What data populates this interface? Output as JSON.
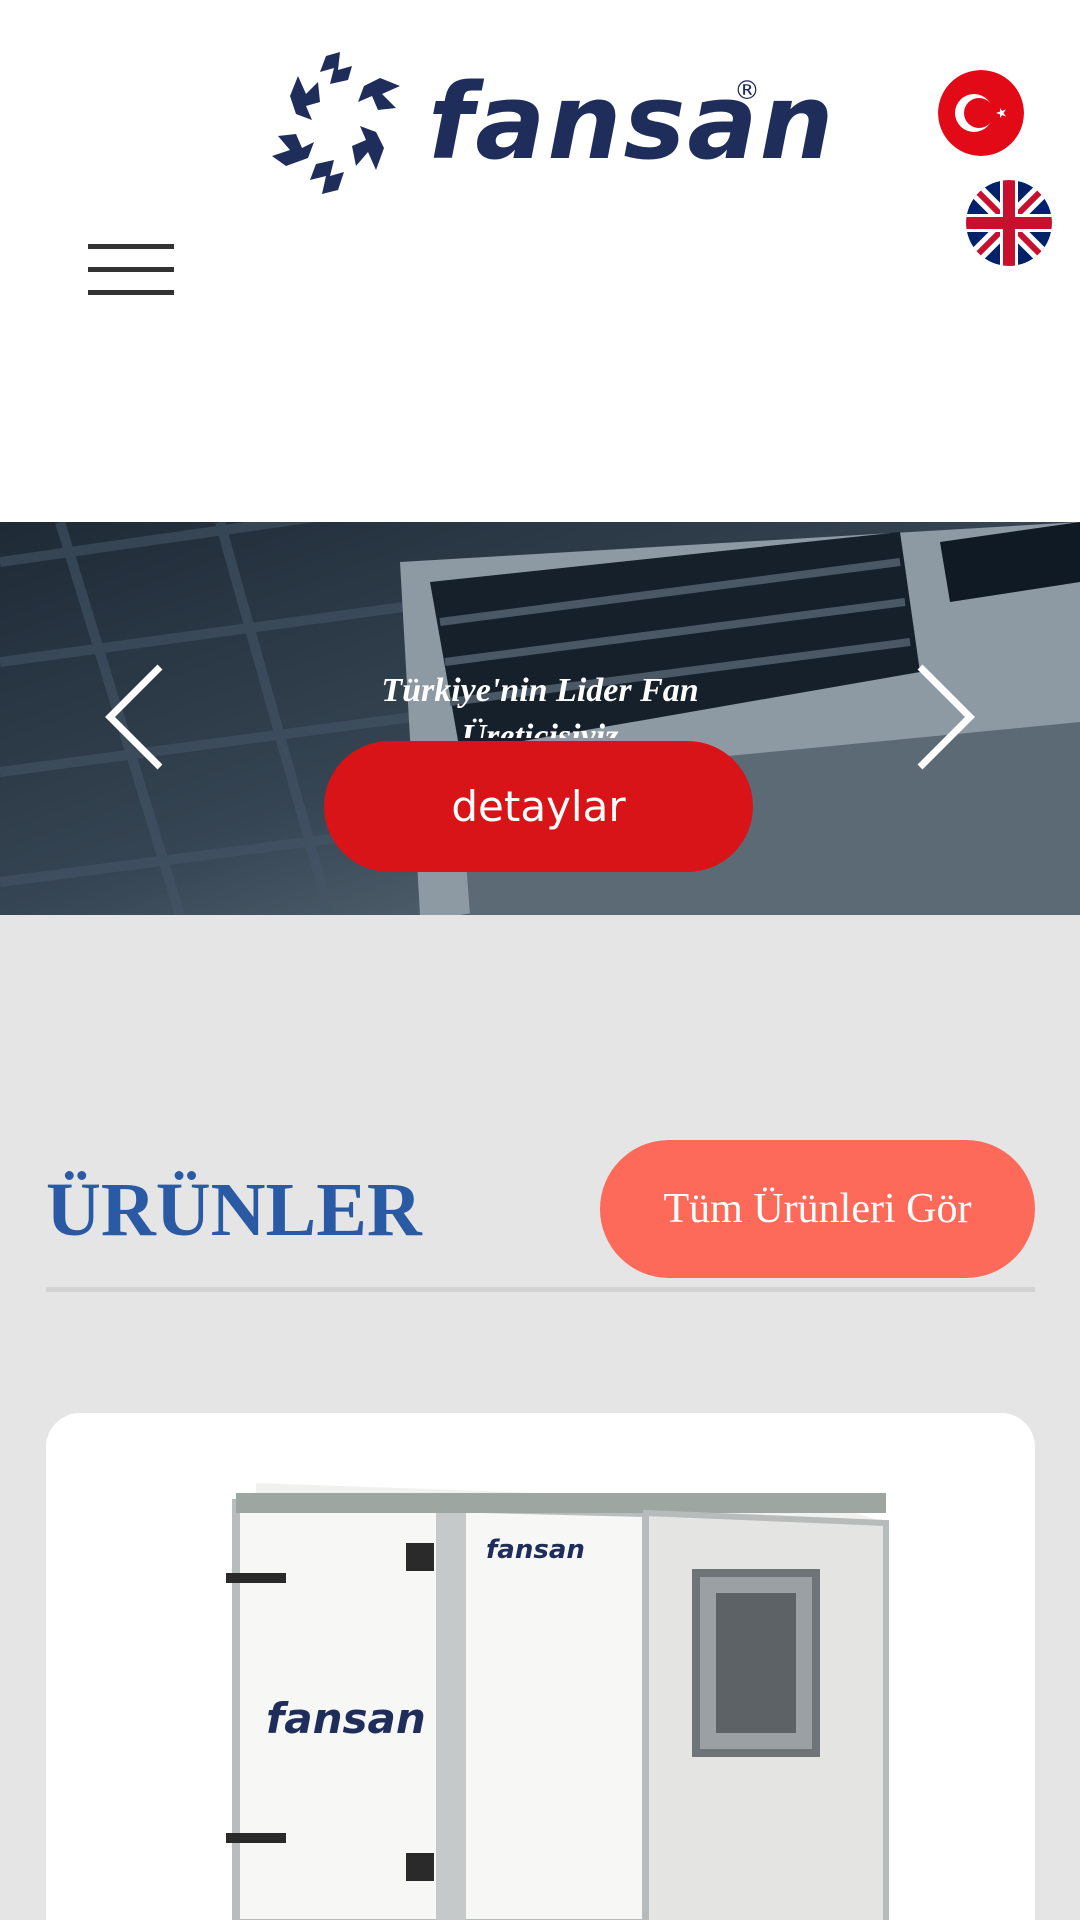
{
  "header": {
    "brand_name": "fansan",
    "brand_registered": "®",
    "languages": [
      {
        "code": "tr",
        "icon": "turkey-flag-icon"
      },
      {
        "code": "en",
        "icon": "uk-flag-icon"
      }
    ],
    "menu_icon": "hamburger-menu-icon"
  },
  "hero": {
    "title": "Türkiye'nin Lider Fan Üreticisiyiz",
    "button_label": "detaylar",
    "prev_icon": "chevron-left-icon",
    "next_icon": "chevron-right-icon"
  },
  "products": {
    "section_title": "ÜRÜNLER",
    "all_button_label": "Tüm Ürünleri Gör",
    "items": [
      {
        "brand_on_unit": "fansan"
      }
    ]
  },
  "colors": {
    "brand_navy": "#1f2d5b",
    "hero_button": "#d91418",
    "section_title": "#2a5aa3",
    "all_button": "#fd6a5a",
    "page_bg": "#e6e5e5"
  }
}
